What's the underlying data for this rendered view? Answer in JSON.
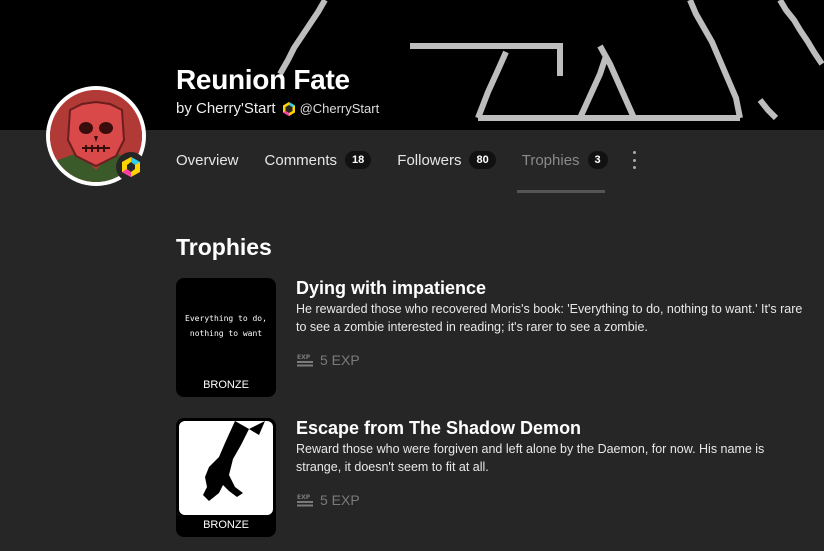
{
  "game": {
    "title": "Reunion Fate",
    "by_label": "by Cherry'Start",
    "handle": "@CherryStart"
  },
  "tabs": [
    {
      "label": "Overview",
      "count": null,
      "active": false
    },
    {
      "label": "Comments",
      "count": "18",
      "active": false
    },
    {
      "label": "Followers",
      "count": "80",
      "active": false
    },
    {
      "label": "Trophies",
      "count": "3",
      "active": true
    }
  ],
  "section": {
    "title": "Trophies"
  },
  "trophies": [
    {
      "title": "Dying with impatience",
      "description": "He rewarded those who recovered Moris's book: 'Everything to do, nothing to want.' It's rare to see a zombie interested in reading; it's rarer to see a zombie.",
      "tier": "BRONZE",
      "exp": "5 EXP",
      "image_text": [
        "Everything to do,",
        "nothing to want"
      ],
      "image_icon": "pixel-text-image"
    },
    {
      "title": "Escape from The Shadow Demon",
      "description": "Reward those who were forgiven and left alone by the Daemon, for now. His name is strange, it doesn't seem to fit at all.",
      "tier": "BRONZE",
      "exp": "5 EXP",
      "image_icon": "shadow-claw-image"
    }
  ],
  "colors": {
    "background": "#262626",
    "banner": "#000000",
    "avatar": "#b13a36",
    "muted": "#7b7b7b"
  }
}
